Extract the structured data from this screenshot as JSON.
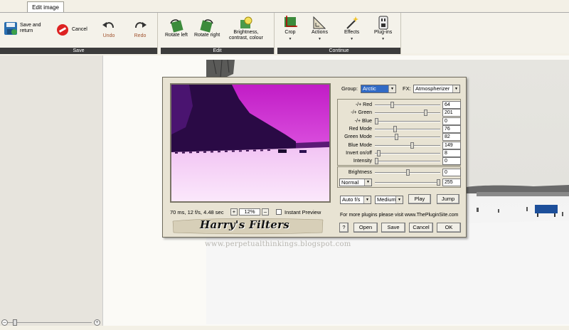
{
  "tab": {
    "label": "Edit image"
  },
  "toolbar": {
    "save_group": {
      "label": "Save",
      "save_return": "Save and\nreturn",
      "cancel": "Cancel",
      "undo": "Undo",
      "redo": "Redo"
    },
    "edit_group": {
      "label": "Edit",
      "rotate_left": "Rotate left",
      "rotate_right": "Rotate right",
      "brightness": "Brightness,\ncontrast, colour"
    },
    "continue_group": {
      "label": "Continue",
      "crop": "Crop",
      "actions": "Actions",
      "effects": "Effects",
      "plugins": "Plug-ins"
    }
  },
  "dialog": {
    "status": "70 ms, 12 f/s, 4.48 sec",
    "zoom": "12%",
    "zoom_plus": "+",
    "zoom_minus": "–",
    "instant_preview": "Instant Preview",
    "title": "Harry's Filters",
    "group_label": "Group:",
    "group_value": "Arctic",
    "fx_label": "FX:",
    "fx_value": "Atmospherizer",
    "sliders": [
      {
        "label": "-/+ Red",
        "value": "64",
        "pos": 0.25
      },
      {
        "label": "-/+ Green",
        "value": "201",
        "pos": 0.79
      },
      {
        "label": "-/+ Blue",
        "value": "0",
        "pos": 0.0
      },
      {
        "label": "Red Mode",
        "value": "76",
        "pos": 0.3
      },
      {
        "label": "Green Mode",
        "value": "82",
        "pos": 0.32
      },
      {
        "label": "Blue Mode",
        "value": "149",
        "pos": 0.58
      },
      {
        "label": "Invert on/off",
        "value": "8",
        "pos": 0.03
      },
      {
        "label": "Intensity",
        "value": "0",
        "pos": 0.0
      }
    ],
    "brightness": {
      "label": "Brightness",
      "value": "0",
      "pos": 0.5
    },
    "blend": {
      "mode": "Normal",
      "value": "255",
      "pos": 1.0
    },
    "play_rate": "Auto f/s",
    "quality": "Medium",
    "play": "Play",
    "jump": "Jump",
    "more_plugins": "For more plugins please visit www.ThePluginSite.com",
    "help": "?",
    "open": "Open",
    "save": "Save",
    "cancel": "Cancel",
    "ok": "OK"
  },
  "watermark": "www.perpetualthinkings.blogspot.com",
  "zoom_slider": {
    "minus": "–",
    "plus": "+",
    "value": 0.05
  }
}
